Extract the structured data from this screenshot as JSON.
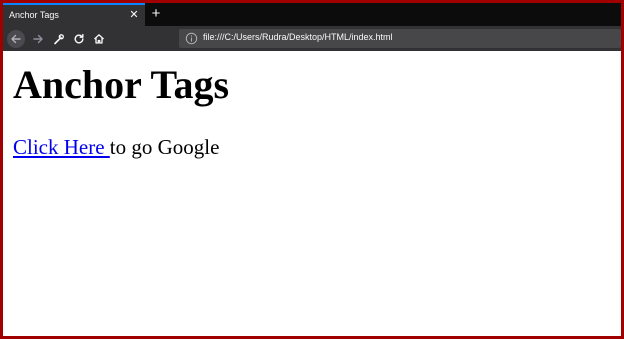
{
  "browser": {
    "tab": {
      "title": "Anchor Tags",
      "close_glyph": "✕"
    },
    "new_tab_glyph": "+",
    "toolbar": {
      "icons": [
        "back-arrow-icon",
        "forward-arrow-icon",
        "wrench-icon",
        "reload-icon",
        "home-icon"
      ]
    },
    "address_bar": {
      "info_icon": "info-icon",
      "url": "file:///C:/Users/Rudra/Desktop/HTML/index.html"
    },
    "colors": {
      "frame_border": "#a00000",
      "tab_strip": "#0c0c0d",
      "toolbar": "#323234",
      "tab_accent": "#0a84ff",
      "link": "#0000ee"
    }
  },
  "page": {
    "heading": "Anchor Tags",
    "link_text": "Click Here ",
    "after_link_text": "to go Google"
  }
}
